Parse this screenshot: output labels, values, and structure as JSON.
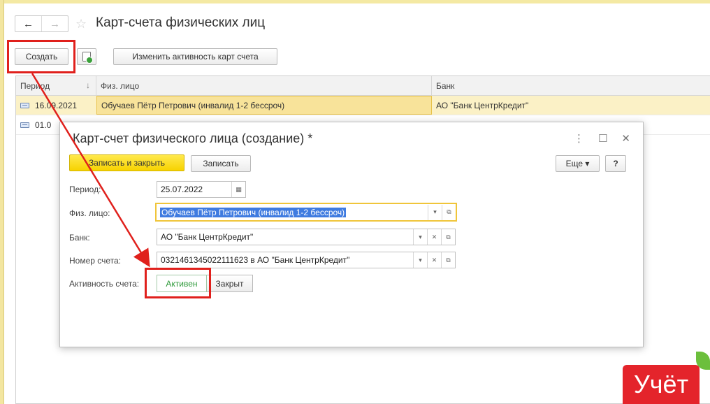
{
  "list_form": {
    "title": "Карт-счета физических лиц",
    "nav": {
      "back_icon": "←",
      "forward_icon": "→"
    },
    "favorite_icon": "☆",
    "toolbar": {
      "create_label": "Создать",
      "toggle_activity_label": "Изменить активность карт счета"
    },
    "columns": {
      "period": "Период",
      "sort_icon": "↓",
      "person": "Физ. лицо",
      "bank": "Банк"
    },
    "rows": [
      {
        "period": "16.09.2021",
        "person": "Обучаев Пётр Петрович (инвалид 1-2 бессроч)",
        "bank": "АО \"Банк ЦентрКредит\""
      },
      {
        "period": "01.0"
      }
    ]
  },
  "dialog": {
    "title": "Карт-счет физического лица (создание) *",
    "controls": {
      "more_icon": "⋮",
      "maximize_icon": "☐",
      "close_icon": "✕"
    },
    "toolbar": {
      "save_close_label": "Записать и закрыть",
      "save_label": "Записать",
      "more_label": "Еще",
      "more_icon": "▾",
      "help_label": "?"
    },
    "fields": {
      "period": {
        "label": "Период:",
        "value": "25.07.2022",
        "calendar_icon": "▦"
      },
      "person": {
        "label": "Физ. лицо:",
        "value": "Обучаев Пётр Петрович (инвалид 1-2 бессроч)"
      },
      "bank": {
        "label": "Банк:",
        "value": "АО \"Банк ЦентрКредит\""
      },
      "account_number": {
        "label": "Номер счета:",
        "value": "0321461345022111623 в АО \"Банк ЦентрКредит\""
      },
      "activity": {
        "label": "Активность счета:",
        "active_label": "Активен",
        "closed_label": "Закрыт"
      }
    },
    "field_icons": {
      "dropdown": "▾",
      "clear": "✕",
      "open": "⧉"
    }
  },
  "branding": {
    "logo_text": "Учёт"
  },
  "colors": {
    "annotation": "#e0201c",
    "accent_yellow": "#f7d300",
    "logo": "#e4242b",
    "active_green": "#2e9a3a"
  }
}
